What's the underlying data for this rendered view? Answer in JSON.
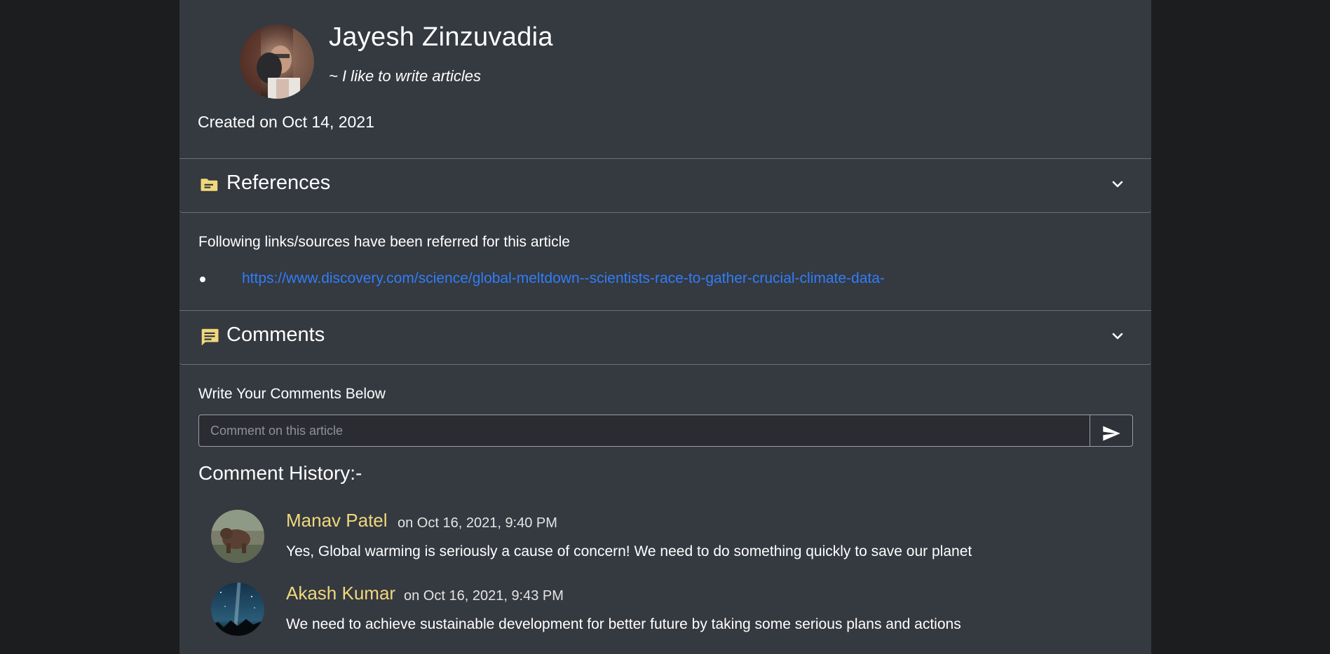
{
  "author": {
    "name": "Jayesh Zinzuvadia",
    "bio": "~ I like to write articles",
    "created": "Created on Oct 14, 2021"
  },
  "references": {
    "heading": "References",
    "icon": "folder-icon",
    "intro": "Following links/sources have been referred for this article",
    "links": [
      "https://www.discovery.com/science/global-meltdown--scientists-race-to-gather-crucial-climate-data-"
    ]
  },
  "comments": {
    "heading": "Comments",
    "icon": "comment-icon",
    "write_label": "Write Your Comments Below",
    "input_placeholder": "Comment on this article",
    "send_icon": "send-icon",
    "history_title": "Comment History:-",
    "items": [
      {
        "name": "Manav Patel",
        "date": "on Oct 16, 2021, 9:40 PM",
        "text": "Yes, Global warming is seriously a cause of concern! We need to do something quickly to save our planet"
      },
      {
        "name": "Akash Kumar",
        "date": "on Oct 16, 2021, 9:43 PM",
        "text": "We need to achieve sustainable development for better future by taking some serious plans and actions"
      }
    ]
  },
  "colors": {
    "page_bg": "#1b1d1e",
    "panel_bg": "#353940",
    "accent_yellow": "#f0d87c",
    "link_blue": "#2f7ef8"
  }
}
